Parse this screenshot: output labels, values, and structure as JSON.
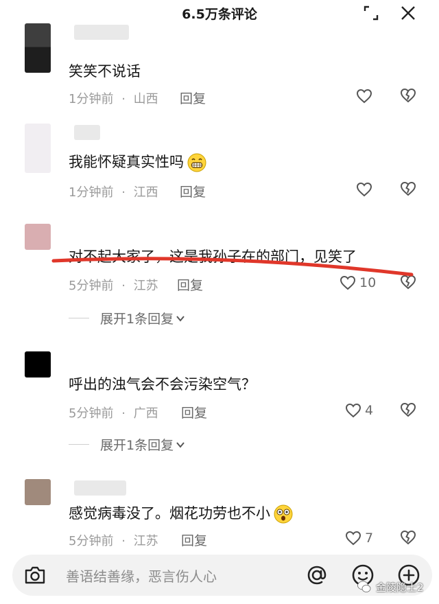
{
  "header": {
    "title": "6.5万条评论"
  },
  "comments": [
    {
      "text": "笑笑不说话",
      "time": "1分钟前",
      "location": "山西",
      "reply": "回复",
      "likes": ""
    },
    {
      "text": "我能怀疑真实性吗",
      "time": "1分钟前",
      "location": "江西",
      "reply": "回复",
      "likes": ""
    },
    {
      "text": "对不起大家了，这是我孙子在的部门，见笑了",
      "time": "5分钟前",
      "location": "江苏",
      "reply": "回复",
      "likes": "10",
      "expand": "展开1条回复"
    },
    {
      "text": "呼出的浊气会不会污染空气？",
      "time": "5分钟前",
      "location": "广西",
      "reply": "回复",
      "likes": "4",
      "expand": "展开1条回复"
    },
    {
      "text": "感觉病毒没了。烟花功劳也不小",
      "time": "5分钟前",
      "location": "江苏",
      "reply": "回复",
      "likes": "7"
    }
  ],
  "meta_separator": "·",
  "input": {
    "placeholder": "善语结善缘，恶言伤人心"
  },
  "icons": {
    "header": [
      "collapse-icon",
      "close-icon"
    ],
    "row": [
      "heart-icon",
      "broken-heart-icon",
      "chevron-down-icon"
    ],
    "bottom": [
      "camera-icon",
      "at-icon",
      "emoji-icon",
      "plus-icon"
    ]
  },
  "watermark": {
    "text": "金陵隐士2"
  },
  "colors": {
    "annotation_line": "#e0372a",
    "meta_text": "#9a9a9a"
  }
}
